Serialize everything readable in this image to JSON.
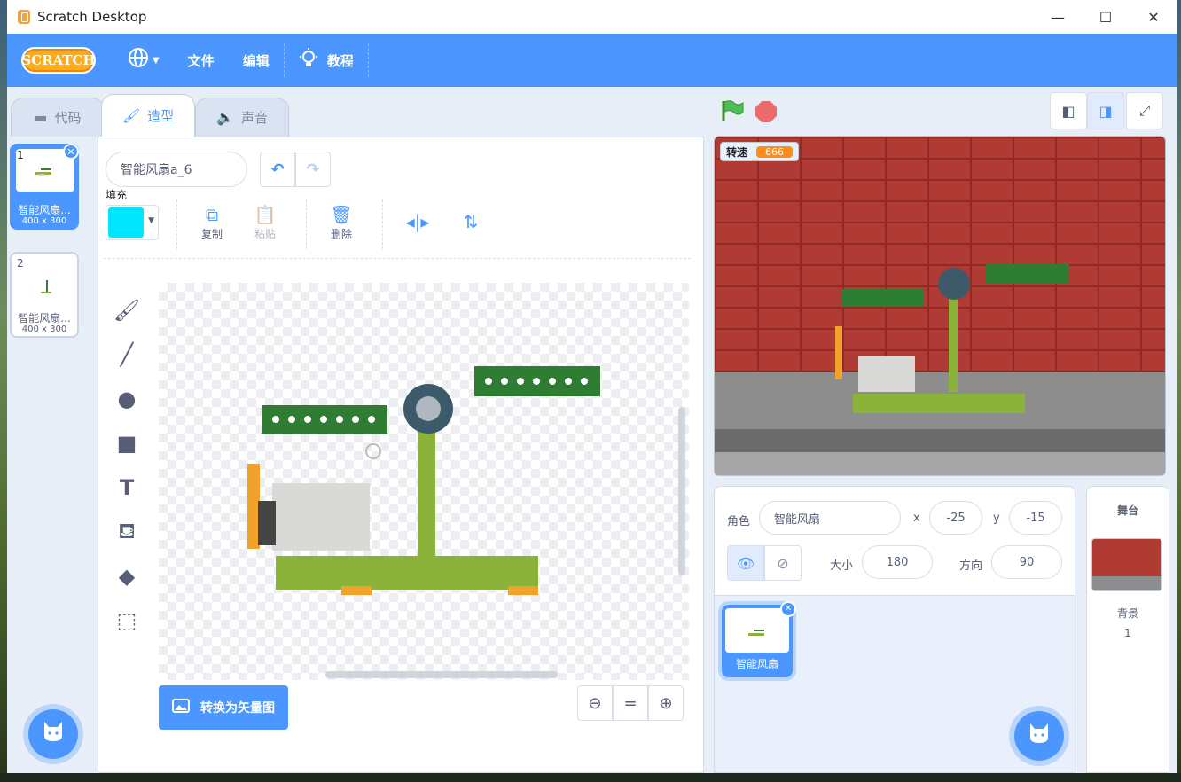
{
  "window": {
    "title": "Scratch Desktop",
    "controls": {
      "minimize": "—",
      "maximize": "☐",
      "close": "✕"
    }
  },
  "menu": {
    "logo": "SCRATCH",
    "language_icon": "🌐",
    "file": "文件",
    "edit": "编辑",
    "tutorials": "教程"
  },
  "tabs": {
    "code": "代码",
    "costumes": "造型",
    "sounds": "声音"
  },
  "costumes": [
    {
      "num": "1",
      "name": "智能风扇...",
      "size": "400 x 300",
      "selected": true
    },
    {
      "num": "2",
      "name": "智能风扇...",
      "size": "400 x 300",
      "selected": false
    }
  ],
  "editor": {
    "costume_name": "智能风扇a_6",
    "fill_label": "填充",
    "fill_color": "#00e6ff",
    "copy": "复制",
    "paste": "粘贴",
    "delete": "删除",
    "convert": "转换为矢量图",
    "zoom_equal": "="
  },
  "stage": {
    "monitor_label": "转速",
    "monitor_value": "666"
  },
  "sprite": {
    "label_sprite": "角色",
    "name": "智能风扇",
    "x_label": "x",
    "x": "-25",
    "y_label": "y",
    "y": "-15",
    "size_label": "大小",
    "size": "180",
    "direction_label": "方向",
    "direction": "90",
    "thumb_name": "智能风扇"
  },
  "stage_panel": {
    "title": "舞台",
    "backdrop_label": "背景",
    "backdrop_count": "1"
  },
  "colors": {
    "accent": "#4c97ff",
    "menubar": "#4c97ff",
    "monitor_value": "#ff8c1a"
  }
}
